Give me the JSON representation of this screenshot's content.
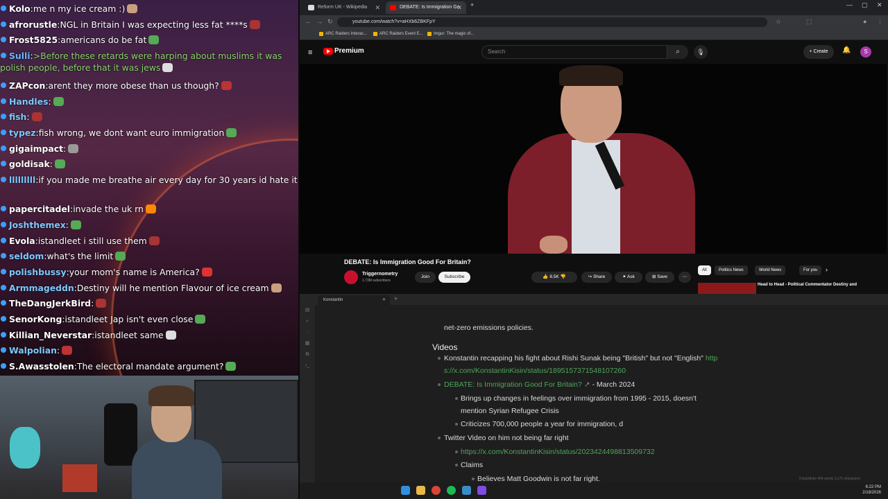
{
  "chat": {
    "messages": [
      {
        "user": "Kolo",
        "text": "me n my ice cream :)",
        "user_color": "#ffffff"
      },
      {
        "user": "afrorustle",
        "text": "NGL in Britain I was expecting less fat ****s",
        "user_color": "#ffffff"
      },
      {
        "user": "Frost5825",
        "text": "americans do be fat",
        "user_color": "#ffffff"
      },
      {
        "user": "Sulli",
        "text": ">Before these retards were harping about muslims it was polish people, before that it was jews",
        "user_color": "#6ab7ff",
        "text_color": "#8bd46b"
      },
      {
        "user": "ZAPcon",
        "text": "arent they more obese than us though?",
        "user_color": "#ffffff"
      },
      {
        "user": "Handles",
        "text": "",
        "user_color": "#7ec8ff"
      },
      {
        "user": "fish",
        "text": "",
        "user_color": "#7ec8ff"
      },
      {
        "user": "typez",
        "text": "fish wrong, we dont want euro immigration",
        "user_color": "#7ec8ff"
      },
      {
        "user": "gigaimpact",
        "text": "",
        "user_color": "#ffffff"
      },
      {
        "user": "goldisak",
        "text": "",
        "user_color": "#ffffff"
      },
      {
        "user": "lllllllll",
        "text": "if you made me breathe air every day for 30 years id hate it",
        "user_color": "#7ec8ff"
      },
      {
        "user": "papercitadel",
        "text": "invade the uk rn",
        "user_color": "#ffffff"
      },
      {
        "user": "Joshthemex",
        "text": "",
        "user_color": "#7ec8ff"
      },
      {
        "user": "Evola",
        "text": "istandleet i still use them",
        "user_color": "#ffffff"
      },
      {
        "user": "seldom",
        "text": "what's the limit",
        "user_color": "#7ec8ff"
      },
      {
        "user": "polishbussy",
        "text": "your mom's name is America?",
        "user_color": "#7ec8ff"
      },
      {
        "user": "Armmageddn",
        "text": "Destiny will he mention Flavour of ice cream",
        "user_color": "#7ec8ff"
      },
      {
        "user": "TheDangJerkBird",
        "text": "",
        "user_color": "#ffffff"
      },
      {
        "user": "SenorKong",
        "text": "istandleet Jap isn't even close",
        "user_color": "#ffffff"
      },
      {
        "user": "Killian_Neverstar",
        "text": "istandleet same",
        "user_color": "#ffffff"
      },
      {
        "user": "Walpolian",
        "text": "",
        "user_color": "#7ec8ff"
      },
      {
        "user": "S.Awasstolen",
        "text": "The electoral mandate argument?",
        "user_color": "#ffffff"
      }
    ]
  },
  "browser": {
    "tabs": [
      {
        "label": "Reform UK - Wikipedia",
        "active": false,
        "favicon_color": "#dddddd"
      },
      {
        "label": "DEBATE: Is Immigration Go",
        "active": true,
        "favicon_color": "#ff0000"
      }
    ],
    "url": "youtube.com/watch?v=aHXb6ZBKFpY",
    "bookmarks": [
      "ARC Raiders Interac...",
      "ARC Raiders Event E...",
      "Imgur: The magic of..."
    ]
  },
  "youtube": {
    "brand": "Premium",
    "search_placeholder": "Search",
    "create_label": "Create",
    "avatar_letter": "S",
    "video_title": "DEBATE: Is Immigration Good For Britain?",
    "channel_name": "Triggernometry",
    "subscribers": "1.73M subscribers",
    "join_label": "Join",
    "subscribe_label": "Subscribe",
    "likes": "8.5K",
    "share_label": "Share",
    "ask_label": "Ask",
    "save_label": "Save",
    "chips": [
      "All",
      "Politics News",
      "World News",
      "For you"
    ],
    "rec_title": "Head to Head - Political Commentator Destiny and"
  },
  "notes": {
    "tab_title": "Konstantin",
    "frag": "net-zero emissions policies.",
    "heading": "Videos",
    "l1_text": "Konstantin recapping his fight about Rishi Sunak being \"British\" but not \"English\"",
    "l1_link_a": "http",
    "l1_link_b": "s://x.com/KonstantinKisin/status/1895157371548107260",
    "l2_link": "DEBATE: Is Immigration Good For Britain?",
    "l2_date": "- March 2024",
    "l3a": "Brings up changes in feelings over immigration from 1995 - 2015, doesn't",
    "l3b": "mention Syrian Refugee Crisis",
    "l4": "Criticizes 700,000 people a year for immigration, d",
    "l5": "Twitter Video on him not being far right",
    "l6_link": "https://x.com/KonstantinKisin/status/2023424498813509732",
    "l7": "Claims",
    "l8": "Believes Matt Goodwin is not far right.",
    "status": "0 backlinks   454 words   3,171 characters"
  },
  "taskbar": {
    "time": "6:22 PM",
    "date": "2/18/2026"
  }
}
